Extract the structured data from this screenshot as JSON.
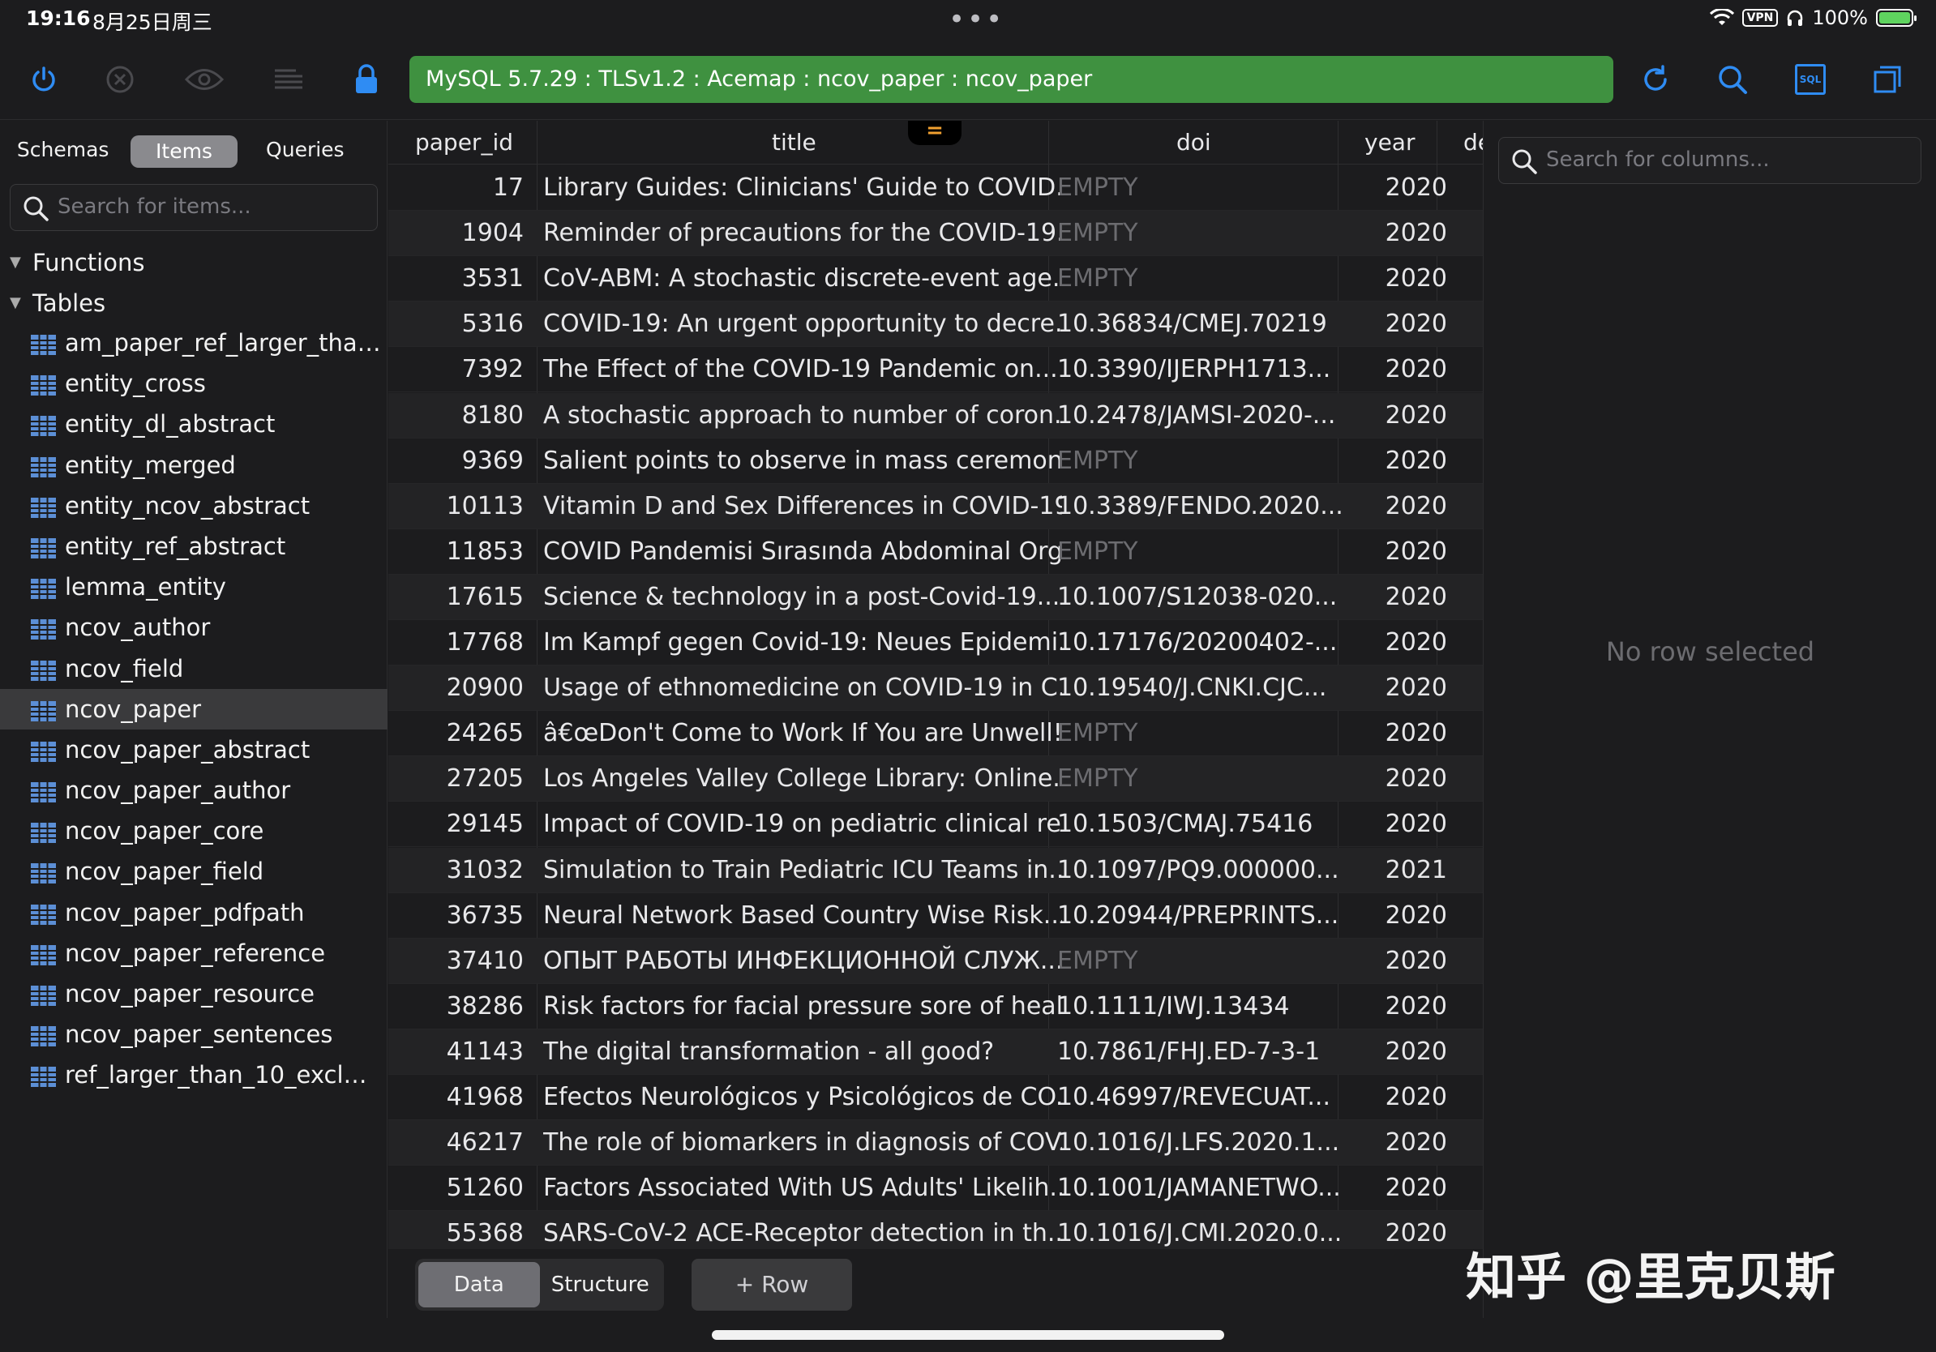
{
  "status": {
    "time": "19:16",
    "date": "8月25日周三",
    "dots": "•••",
    "vpn": "VPN",
    "battery": "100%"
  },
  "toolbar": {
    "connection": "MySQL 5.7.29 : TLSv1.2 : Acemap : ncov_paper : ncov_paper",
    "icons": [
      "power-icon",
      "disconnect-icon",
      "eye-icon",
      "filter-list-icon",
      "lock-icon",
      "refresh-icon",
      "search-icon",
      "sql-icon",
      "window-icon"
    ],
    "sql_label": "SQL",
    "accent": "#3f9140",
    "icon_color": "#2f8cf3"
  },
  "sidebar": {
    "tabs": [
      "Schemas",
      "Items",
      "Queries"
    ],
    "active_tab": "Items",
    "search_placeholder": "Search for items...",
    "groups": {
      "functions": "Functions",
      "tables": "Tables"
    },
    "tables": [
      "am_paper_ref_larger_than...",
      "entity_cross",
      "entity_dl_abstract",
      "entity_merged",
      "entity_ncov_abstract",
      "entity_ref_abstract",
      "lemma_entity",
      "ncov_author",
      "ncov_field",
      "ncov_paper",
      "ncov_paper_abstract",
      "ncov_paper_author",
      "ncov_paper_core",
      "ncov_paper_field",
      "ncov_paper_pdfpath",
      "ncov_paper_reference",
      "ncov_paper_resource",
      "ncov_paper_sentences",
      "ref_larger_than_10_exclud..."
    ],
    "selected_table": "ncov_paper"
  },
  "grid": {
    "columns": [
      "paper_id",
      "title",
      "doi",
      "year",
      "de"
    ],
    "handle": "=",
    "rows": [
      {
        "paper_id": "17",
        "title": "Library Guides: Clinicians' Guide to COVID...",
        "doi": "EMPTY",
        "year": "2020"
      },
      {
        "paper_id": "1904",
        "title": "Reminder of precautions for the COVID-19...",
        "doi": "EMPTY",
        "year": "2020"
      },
      {
        "paper_id": "3531",
        "title": "CoV-ABM: A stochastic discrete-event age...",
        "doi": "EMPTY",
        "year": "2020"
      },
      {
        "paper_id": "5316",
        "title": "COVID-19: An urgent opportunity to decre...",
        "doi": "10.36834/CMEJ.70219",
        "year": "2020"
      },
      {
        "paper_id": "7392",
        "title": "The Effect of the COVID-19 Pandemic on...",
        "doi": "10.3390/IJERPH1713...",
        "year": "2020"
      },
      {
        "paper_id": "8180",
        "title": "A stochastic approach to number of coron...",
        "doi": "10.2478/JAMSI-2020-...",
        "year": "2020"
      },
      {
        "paper_id": "9369",
        "title": "Salient points to observe in mass ceremoni...",
        "doi": "EMPTY",
        "year": "2020"
      },
      {
        "paper_id": "10113",
        "title": "Vitamin D and Sex Differences in COVID-19",
        "doi": "10.3389/FENDO.2020...",
        "year": "2020"
      },
      {
        "paper_id": "11853",
        "title": "COVID Pandemisi Sırasında Abdominal Org...",
        "doi": "EMPTY",
        "year": "2020"
      },
      {
        "paper_id": "17615",
        "title": "Science & technology in a post-Covid-19...",
        "doi": "10.1007/S12038-020...",
        "year": "2020"
      },
      {
        "paper_id": "17768",
        "title": "Im Kampf gegen Covid-19: Neues Epidemi...",
        "doi": "10.17176/20200402-...",
        "year": "2020"
      },
      {
        "paper_id": "20900",
        "title": "Usage of ethnomedicine on COVID-19 in C...",
        "doi": "10.19540/J.CNKI.CJC...",
        "year": "2020"
      },
      {
        "paper_id": "24265",
        "title": "â€œDon't Come to Work If You are Unwell!...",
        "doi": "EMPTY",
        "year": "2020"
      },
      {
        "paper_id": "27205",
        "title": "Los Angeles Valley College Library: Online...",
        "doi": "EMPTY",
        "year": "2020"
      },
      {
        "paper_id": "29145",
        "title": "Impact of COVID-19 on pediatric clinical re...",
        "doi": "10.1503/CMAJ.75416",
        "year": "2020"
      },
      {
        "paper_id": "31032",
        "title": "Simulation to Train Pediatric ICU Teams in...",
        "doi": "10.1097/PQ9.000000...",
        "year": "2021"
      },
      {
        "paper_id": "36735",
        "title": "Neural Network Based Country Wise Risk...",
        "doi": "10.20944/PREPRINTS...",
        "year": "2020"
      },
      {
        "paper_id": "37410",
        "title": "ОПЫТ РАБОТЫ ИНФЕКЦИОННОЙ СЛУЖ...",
        "doi": "EMPTY",
        "year": "2020"
      },
      {
        "paper_id": "38286",
        "title": "Risk factors for facial pressure sore of heal...",
        "doi": "10.1111/IWJ.13434",
        "year": "2020"
      },
      {
        "paper_id": "41143",
        "title": "The digital transformation - all good?",
        "doi": "10.7861/FHJ.ED-7-3-1",
        "year": "2020"
      },
      {
        "paper_id": "41968",
        "title": "Efectos Neurológicos y Psicológicos de CO...",
        "doi": "10.46997/REVECUAT...",
        "year": "2020"
      },
      {
        "paper_id": "46217",
        "title": "The role of biomarkers in diagnosis of COV...",
        "doi": "10.1016/J.LFS.2020.1...",
        "year": "2020"
      },
      {
        "paper_id": "51260",
        "title": "Factors Associated With US Adults' Likelih...",
        "doi": "10.1001/JAMANETWO...",
        "year": "2020"
      },
      {
        "paper_id": "55368",
        "title": "SARS-CoV-2 ACE-Receptor detection in th...",
        "doi": "10.1016/J.CMI.2020.0...",
        "year": "2020"
      }
    ]
  },
  "bottom": {
    "tabs": [
      "Data",
      "Structure"
    ],
    "active_tab": "Data",
    "add_row": "+ Row"
  },
  "details": {
    "search_placeholder": "Search for columns...",
    "empty_text": "No row selected"
  },
  "watermark": "知乎 @里克贝斯"
}
